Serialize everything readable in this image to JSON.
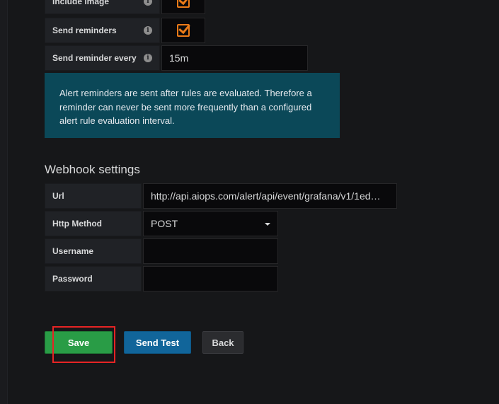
{
  "notification": {
    "include_image": {
      "label": "Include image",
      "checked": true
    },
    "send_reminders": {
      "label": "Send reminders",
      "checked": true
    },
    "send_reminder_every": {
      "label": "Send reminder every",
      "value": "15m"
    },
    "info_icon_glyph": "i",
    "reminder_info": "Alert reminders are sent after rules are evaluated. Therefore a reminder can never be sent more frequently than a configured alert rule evaluation interval."
  },
  "webhook": {
    "title": "Webhook settings",
    "url": {
      "label": "Url",
      "value": "http://api.aiops.com/alert/api/event/grafana/v1/1ed…"
    },
    "http_method": {
      "label": "Http Method",
      "value": "POST"
    },
    "username": {
      "label": "Username",
      "value": ""
    },
    "password": {
      "label": "Password",
      "value": ""
    }
  },
  "buttons": {
    "save": "Save",
    "send_test": "Send Test",
    "back": "Back"
  },
  "colors": {
    "accent_orange": "#eb7b18",
    "save_green": "#299c46",
    "send_test_blue": "#11659a",
    "info_bg": "#0b4858",
    "highlight_red": "#e62424"
  },
  "icons": {
    "info": "info-icon",
    "checkbox": "checkbox-checked-icon",
    "caret": "caret-down-icon"
  }
}
